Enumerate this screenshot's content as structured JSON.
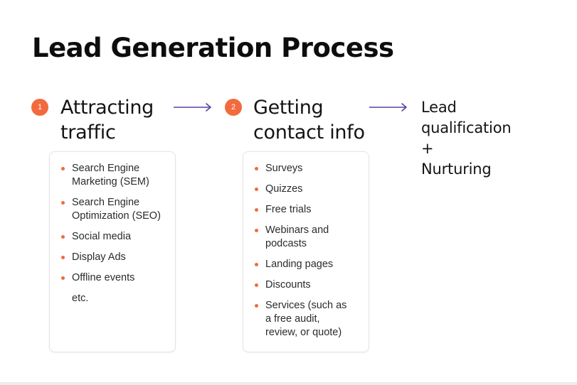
{
  "title": "Lead Generation Process",
  "colors": {
    "accent": "#f26a3d",
    "arrow": "#5b3fa0",
    "text": "#141414",
    "card_border": "#e4e4e4"
  },
  "steps": [
    {
      "number": "1",
      "title_lines": [
        "Attracting",
        "traffic"
      ],
      "items": [
        "Search Engine Marketing (SEM)",
        "Search Engine Optimization (SEO)",
        "Social media",
        "Display Ads",
        "Offline events"
      ],
      "footer": "etc."
    },
    {
      "number": "2",
      "title_lines": [
        "Getting",
        "contact info"
      ],
      "items": [
        "Surveys",
        "Quizzes",
        "Free trials",
        "Webinars and podcasts",
        "Landing pages",
        "Discounts",
        "Services (such as a free audit, review, or quote)"
      ]
    }
  ],
  "final_step": {
    "lines": [
      "Lead",
      "qualification",
      "+",
      "Nurturing"
    ]
  },
  "icons": {
    "step_badge": "numbered-circle",
    "connector": "right-arrow-icon",
    "bullet": "dot-bullet-icon"
  }
}
